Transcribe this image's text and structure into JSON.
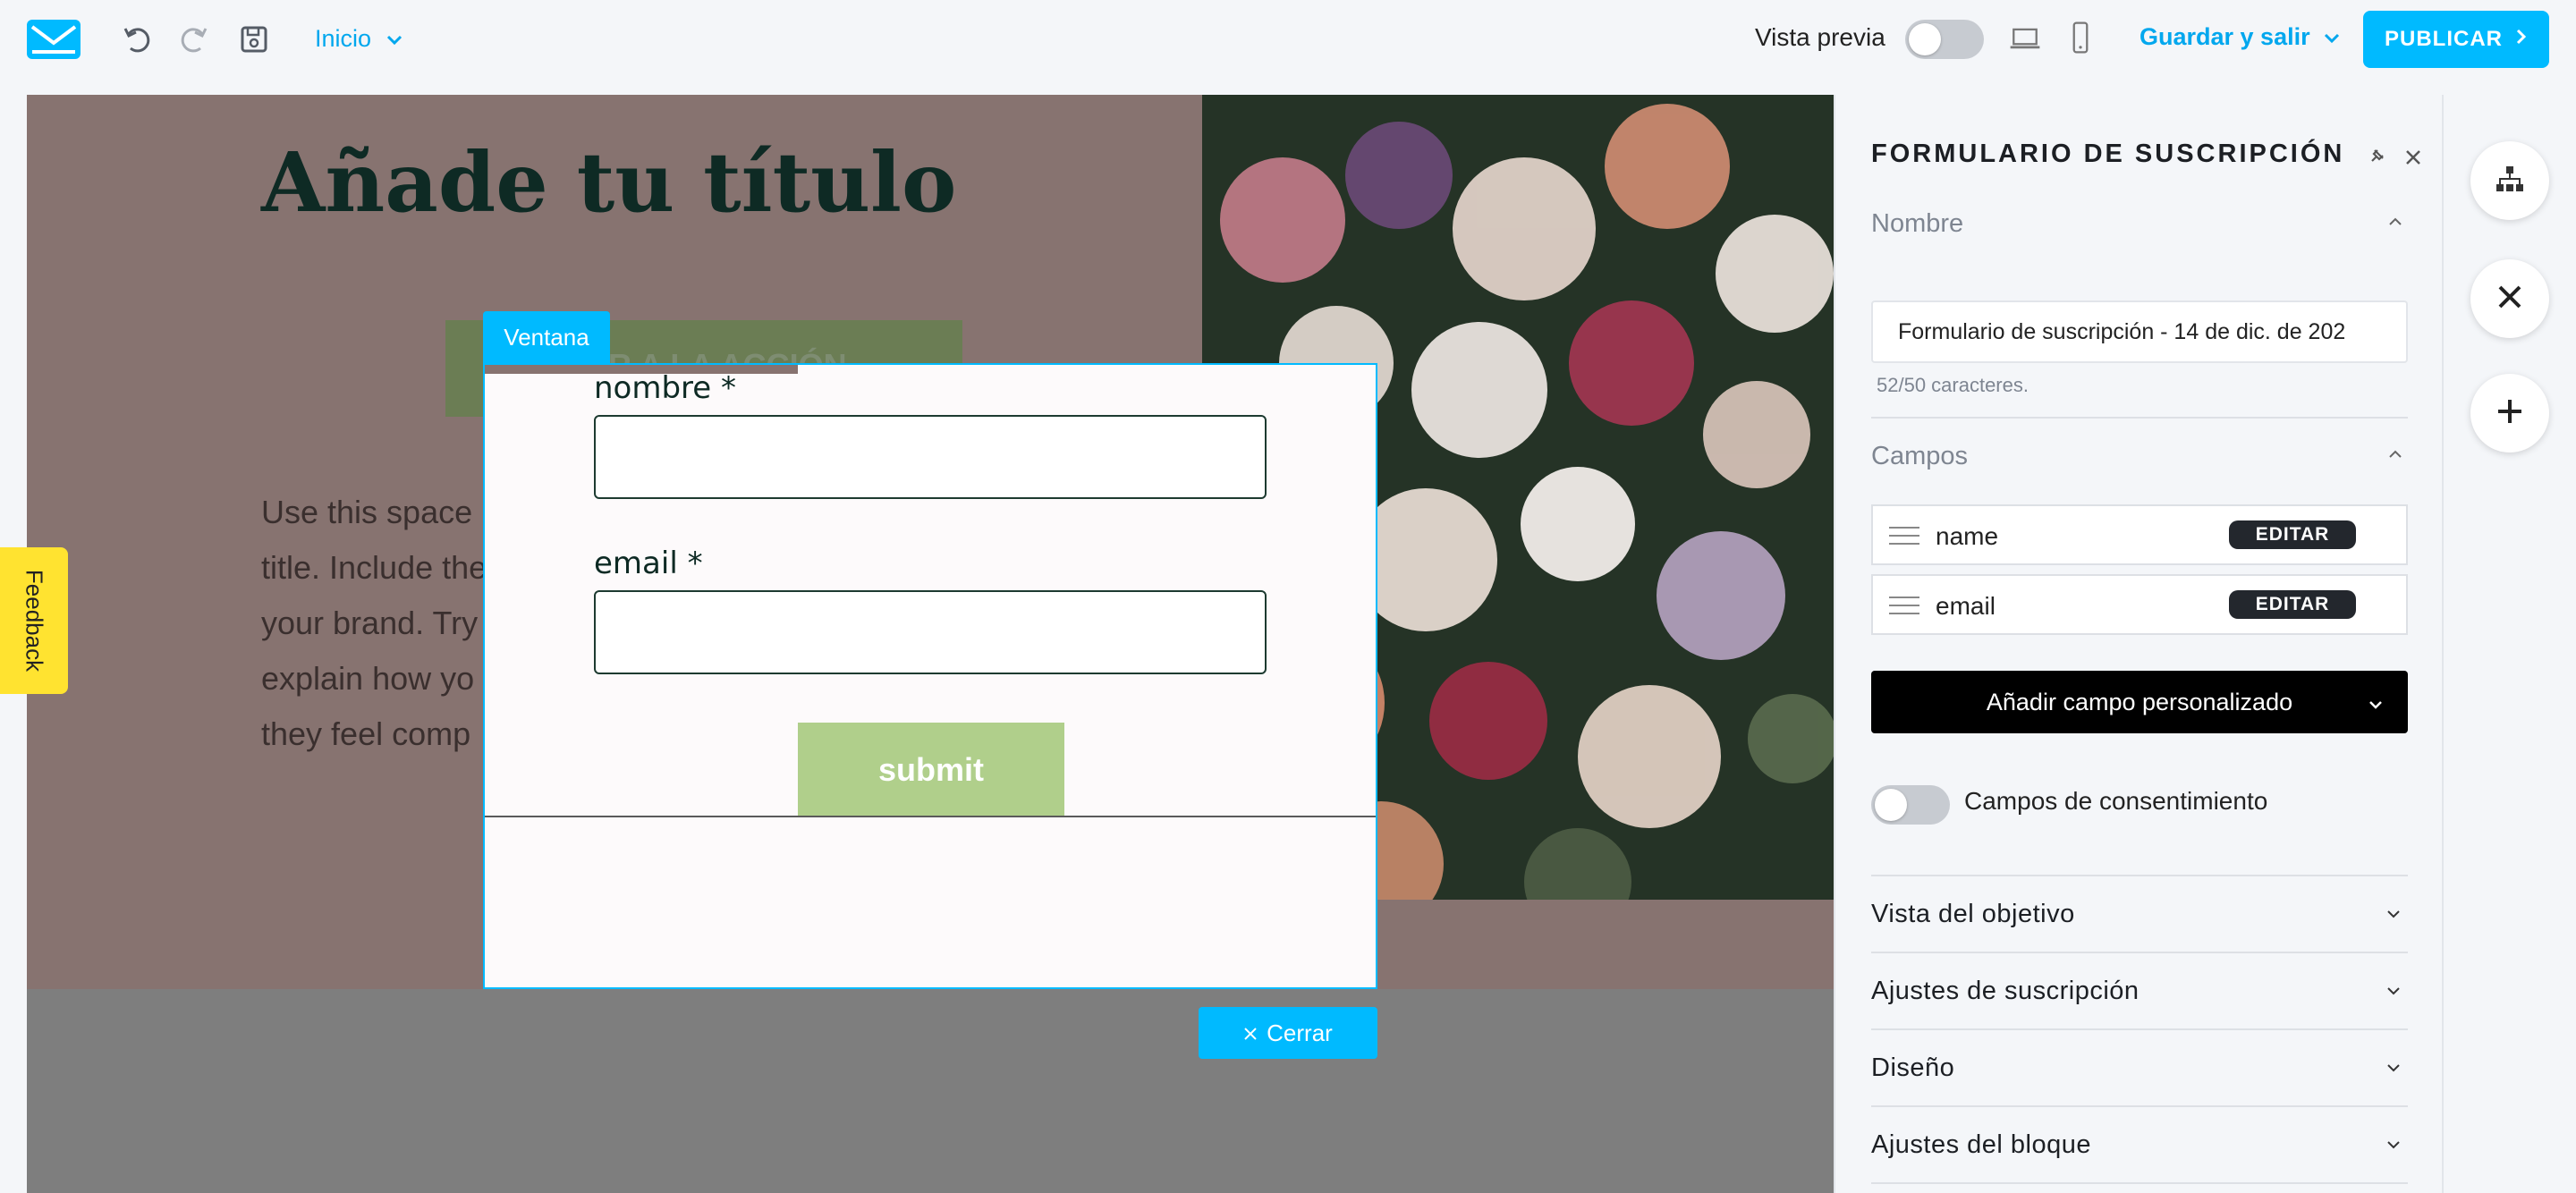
{
  "topbar": {
    "breadcrumb": "Inicio",
    "preview_label": "Vista previa",
    "preview_on": false,
    "save_exit_label": "Guardar y salir",
    "publish_label": "PUBLICAR"
  },
  "canvas": {
    "hero_title": "Añade tu título",
    "cta_text": "IR A LA ACCIÓN",
    "body_lines": [
      "Use this space",
      "title. Include the",
      "your brand. Try",
      "explain how yo",
      "they feel comp"
    ],
    "window_tab": "Ventana",
    "form": {
      "name_label": "nombre *",
      "email_label": "email *",
      "submit_label": "submit"
    },
    "close_label": "Cerrar",
    "feedback_label": "Feedback"
  },
  "panel": {
    "title": "FORMULARIO DE SUSCRIPCIÓN",
    "name_section": "Nombre",
    "name_value": "Formulario de suscripción - 14 de dic. de 202",
    "char_count": "52/50 caracteres.",
    "fields_section": "Campos",
    "fields": [
      {
        "name": "name",
        "edit": "EDITAR"
      },
      {
        "name": "email",
        "edit": "EDITAR"
      }
    ],
    "add_field_label": "Añadir campo personalizado",
    "consent_label": "Campos de consentimiento",
    "consent_on": false,
    "accordions": [
      "Vista del objetivo",
      "Ajustes de suscripción",
      "Diseño",
      "Ajustes del bloque"
    ]
  },
  "colors": {
    "accent": "#00baff",
    "hero_overlay": "#877370",
    "submit": "#b0cf8b",
    "feedback": "#ffe330"
  },
  "icons": [
    "logo-envelope-icon",
    "undo-icon",
    "redo-icon",
    "save-icon",
    "chevron-down-icon",
    "laptop-icon",
    "mobile-icon",
    "chevron-right-icon",
    "pin-icon",
    "close-icon",
    "sitemap-icon",
    "plus-icon",
    "drag-handle-icon"
  ]
}
